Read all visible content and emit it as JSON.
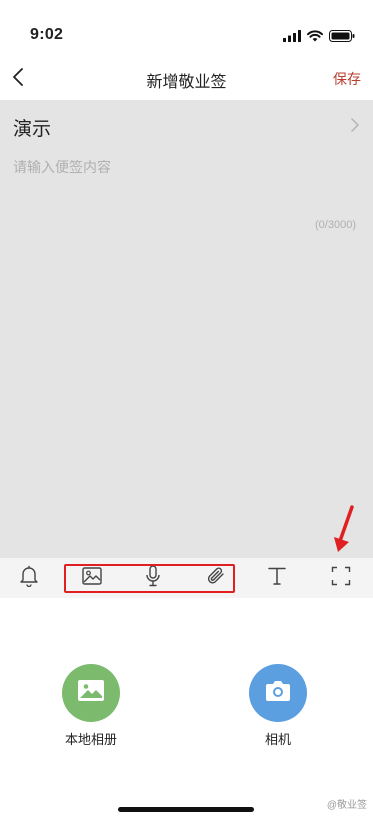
{
  "status_bar": {
    "time": "9:02"
  },
  "nav": {
    "title": "新增敬业签",
    "save_label": "保存"
  },
  "editor": {
    "category": "演示",
    "placeholder": "请输入便签内容",
    "char_count": "(0/3000)"
  },
  "toolbar": {
    "items": [
      "bell-icon",
      "image-icon",
      "microphone-icon",
      "paperclip-icon",
      "text-format-icon",
      "fullscreen-icon"
    ]
  },
  "attach": {
    "album_label": "本地相册",
    "album_color": "#7cbb6e",
    "camera_label": "相机",
    "camera_color": "#5b9fe0"
  },
  "watermark": "@敬业签",
  "colors": {
    "accent": "#b84030",
    "annotation": "#e02020",
    "editor_bg": "#e4e4e4"
  }
}
